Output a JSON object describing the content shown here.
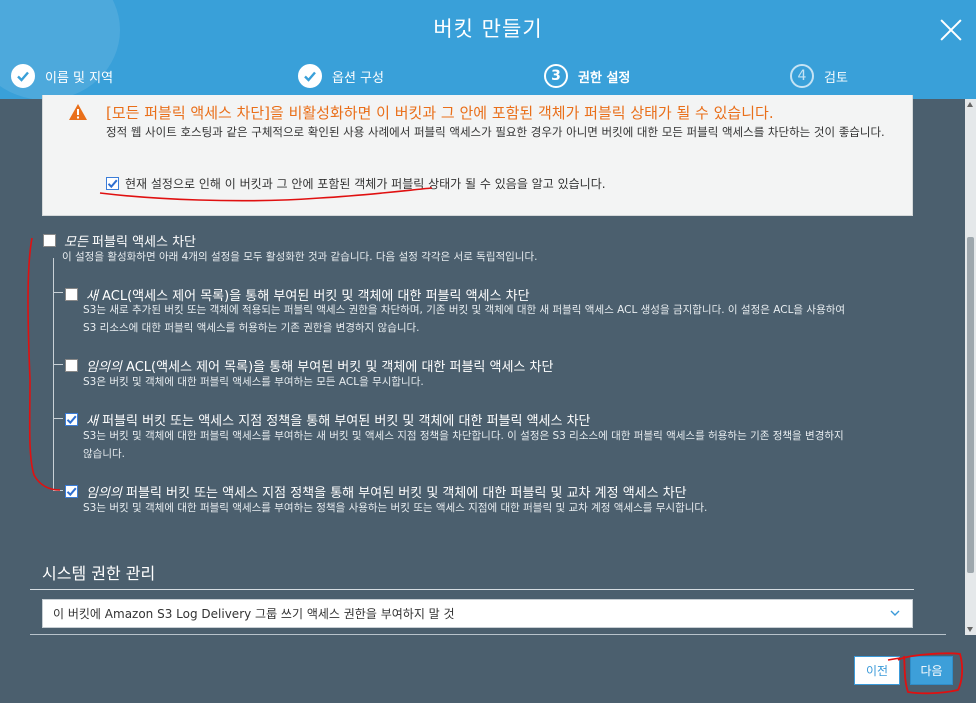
{
  "header": {
    "title": "버킷 만들기",
    "steps": [
      {
        "num": "1",
        "label": "이름 및 지역",
        "state": "done"
      },
      {
        "num": "2",
        "label": "옵션 구성",
        "state": "done"
      },
      {
        "num": "3",
        "label": "권한 설정",
        "state": "active"
      },
      {
        "num": "4",
        "label": "검토",
        "state": "pending"
      }
    ]
  },
  "warning": {
    "headline": "[모든 퍼블릭 액세스 차단]을 비활성화하면 이 버킷과 그 안에 포함된 객체가 퍼블릭 상태가 될 수 있습니다.",
    "description": "정적 웹 사이트 호스팅과 같은 구체적으로 확인된 사용 사례에서 퍼블릭 액세스가 필요한 경우가 아니면 버킷에 대한 모든 퍼블릭 액세스를 차단하는 것이 좋습니다.",
    "ack_label": "현재 설정으로 인해 이 버킷과 그 안에 포함된 객체가 퍼블릭 상태가 될 수 있음을 알고 있습니다.",
    "ack_checked": true
  },
  "block_all": {
    "title_italic": "모든",
    "title_rest": " 퍼블릭 액세스 차단",
    "desc": "이 설정을 활성화하면 아래 4개의 설정을 모두 활성화한 것과 같습니다. 다음 설정 각각은 서로 독립적입니다.",
    "checked": false
  },
  "options": [
    {
      "italic": "새",
      "rest": " ACL(액세스 제어 목록)을 통해 부여된 버킷 및 객체에 대한 퍼블릭 액세스 차단",
      "desc1": "S3는 새로 추가된 버킷 또는 객체에 적용되는 퍼블릭 액세스 권한을 차단하며, 기존 버킷 및 객체에 대한 새 퍼블릭 액세스 ACL 생성을 금지합니다. 이 설정은 ACL을 사용하여",
      "desc2": "S3 리소스에 대한 퍼블릭 액세스를 허용하는 기존 권한을 변경하지 않습니다.",
      "checked": false
    },
    {
      "italic": "임의의",
      "rest": " ACL(액세스 제어 목록)을 통해 부여된 버킷 및 객체에 대한 퍼블릭 액세스 차단",
      "desc1": "S3은 버킷 및 객체에 대한 퍼블릭 액세스를 부여하는 모든 ACL을 무시합니다.",
      "desc2": "",
      "checked": false
    },
    {
      "italic": "새",
      "rest": " 퍼블릭 버킷 또는 액세스 지점 정책을 통해 부여된 버킷 및 객체에 대한 퍼블릭 액세스 차단",
      "desc1": "S3는 버킷 및 객체에 대한 퍼블릭 액세스를 부여하는 새 버킷 및 액세스 지점 정책을 차단합니다. 이 설정은 S3 리소스에 대한 퍼블릭 액세스를 허용하는 기존 정책을 변경하지",
      "desc2": "않습니다.",
      "checked": true
    },
    {
      "italic": "임의의",
      "rest": " 퍼블릭 버킷 또는 액세스 지점 정책을 통해 부여된 버킷 및 객체에 대한 퍼블릭 및 교차 계정 액세스 차단",
      "desc1": "S3는 버킷 및 객체에 대한 퍼블릭 액세스를 부여하는 정책을 사용하는 버킷 또는 액세스 지점에 대한 퍼블릭 및 교차 계정 액세스를 무시합니다.",
      "desc2": "",
      "checked": true
    }
  ],
  "system": {
    "title": "시스템 권한 관리",
    "select_value": "이 버킷에 Amazon S3 Log Delivery 그룹 쓰기 액세스 권한을 부여하지 말 것"
  },
  "footer": {
    "prev_label": "이전",
    "next_label": "다음"
  },
  "colors": {
    "header_bg": "#39a0d9",
    "body_bg": "#4b5f6e",
    "warning_text": "#e96f1a",
    "annotation_red": "#e01010"
  }
}
